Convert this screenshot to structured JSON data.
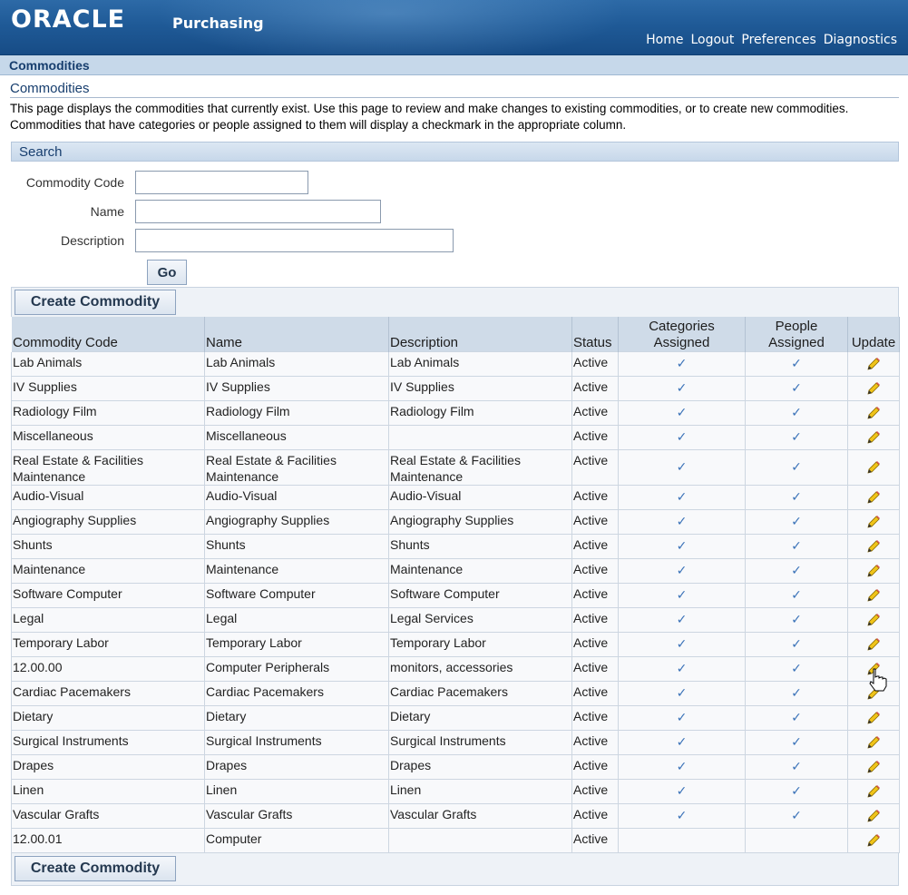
{
  "header": {
    "logo": "ORACLE",
    "app_name": "Purchasing",
    "links": [
      "Home",
      "Logout",
      "Preferences",
      "Diagnostics"
    ]
  },
  "breadcrumb": "Commodities",
  "page_title": "Commodities",
  "instructions": "This page displays the commodities that currently exist. Use this page to review and make changes to existing commodities, or to create new commodities. Commodities that have categories or people assigned to them will display a checkmark in the appropriate column.",
  "search": {
    "header": "Search",
    "fields": [
      {
        "label": "Commodity Code",
        "value": ""
      },
      {
        "label": "Name",
        "value": ""
      },
      {
        "label": "Description",
        "value": ""
      }
    ],
    "go_label": "Go"
  },
  "create_label": "Create Commodity",
  "columns": {
    "code": "Commodity Code",
    "name": "Name",
    "description": "Description",
    "status": "Status",
    "categories_l1": "Categories",
    "categories_l2": "Assigned",
    "people_l1": "People",
    "people_l2": "Assigned",
    "update": "Update"
  },
  "rows": [
    {
      "code": "Lab Animals",
      "name": "Lab Animals",
      "description": "Lab Animals",
      "status": "Active",
      "categories": true,
      "people": true
    },
    {
      "code": "IV Supplies",
      "name": "IV Supplies",
      "description": "IV Supplies",
      "status": "Active",
      "categories": true,
      "people": true
    },
    {
      "code": "Radiology Film",
      "name": "Radiology Film",
      "description": "Radiology Film",
      "status": "Active",
      "categories": true,
      "people": true
    },
    {
      "code": "Miscellaneous",
      "name": "Miscellaneous",
      "description": "",
      "status": "Active",
      "categories": true,
      "people": true
    },
    {
      "code": "Real Estate & Facilities Maintenance",
      "name": "Real Estate & Facilities Maintenance",
      "description": "Real Estate & Facilities Maintenance",
      "status": "Active",
      "categories": true,
      "people": true,
      "tall": true
    },
    {
      "code": "Audio-Visual",
      "name": "Audio-Visual",
      "description": "Audio-Visual",
      "status": "Active",
      "categories": true,
      "people": true
    },
    {
      "code": "Angiography Supplies",
      "name": "Angiography Supplies",
      "description": "Angiography Supplies",
      "status": "Active",
      "categories": true,
      "people": true
    },
    {
      "code": "Shunts",
      "name": "Shunts",
      "description": "Shunts",
      "status": "Active",
      "categories": true,
      "people": true
    },
    {
      "code": "Maintenance",
      "name": "Maintenance",
      "description": "Maintenance",
      "status": "Active",
      "categories": true,
      "people": true
    },
    {
      "code": "Software Computer",
      "name": "Software Computer",
      "description": "Software Computer",
      "status": "Active",
      "categories": true,
      "people": true
    },
    {
      "code": "Legal",
      "name": "Legal",
      "description": "Legal Services",
      "status": "Active",
      "categories": true,
      "people": true
    },
    {
      "code": "Temporary Labor",
      "name": "Temporary Labor",
      "description": "Temporary Labor",
      "status": "Active",
      "categories": true,
      "people": true
    },
    {
      "code": "12.00.00",
      "name": "Computer Peripherals",
      "description": "monitors, accessories",
      "status": "Active",
      "categories": true,
      "people": true
    },
    {
      "code": "Cardiac Pacemakers",
      "name": "Cardiac Pacemakers",
      "description": "Cardiac Pacemakers",
      "status": "Active",
      "categories": true,
      "people": true
    },
    {
      "code": "Dietary",
      "name": "Dietary",
      "description": "Dietary",
      "status": "Active",
      "categories": true,
      "people": true
    },
    {
      "code": "Surgical Instruments",
      "name": "Surgical Instruments",
      "description": "Surgical Instruments",
      "status": "Active",
      "categories": true,
      "people": true
    },
    {
      "code": "Drapes",
      "name": "Drapes",
      "description": "Drapes",
      "status": "Active",
      "categories": true,
      "people": true
    },
    {
      "code": "Linen",
      "name": "Linen",
      "description": "Linen",
      "status": "Active",
      "categories": true,
      "people": true
    },
    {
      "code": "Vascular Grafts",
      "name": "Vascular Grafts",
      "description": "Vascular Grafts",
      "status": "Active",
      "categories": true,
      "people": true
    },
    {
      "code": "12.00.01",
      "name": "Computer",
      "description": "",
      "status": "Active",
      "categories": false,
      "people": false
    }
  ],
  "icons": {
    "check": "checkmark-icon",
    "update": "pencil-icon",
    "cursor": "hand-cursor-icon"
  },
  "colors": {
    "header_blue": "#1f5a97",
    "link_blue": "#173e6e",
    "check_blue": "#3a72b8"
  }
}
